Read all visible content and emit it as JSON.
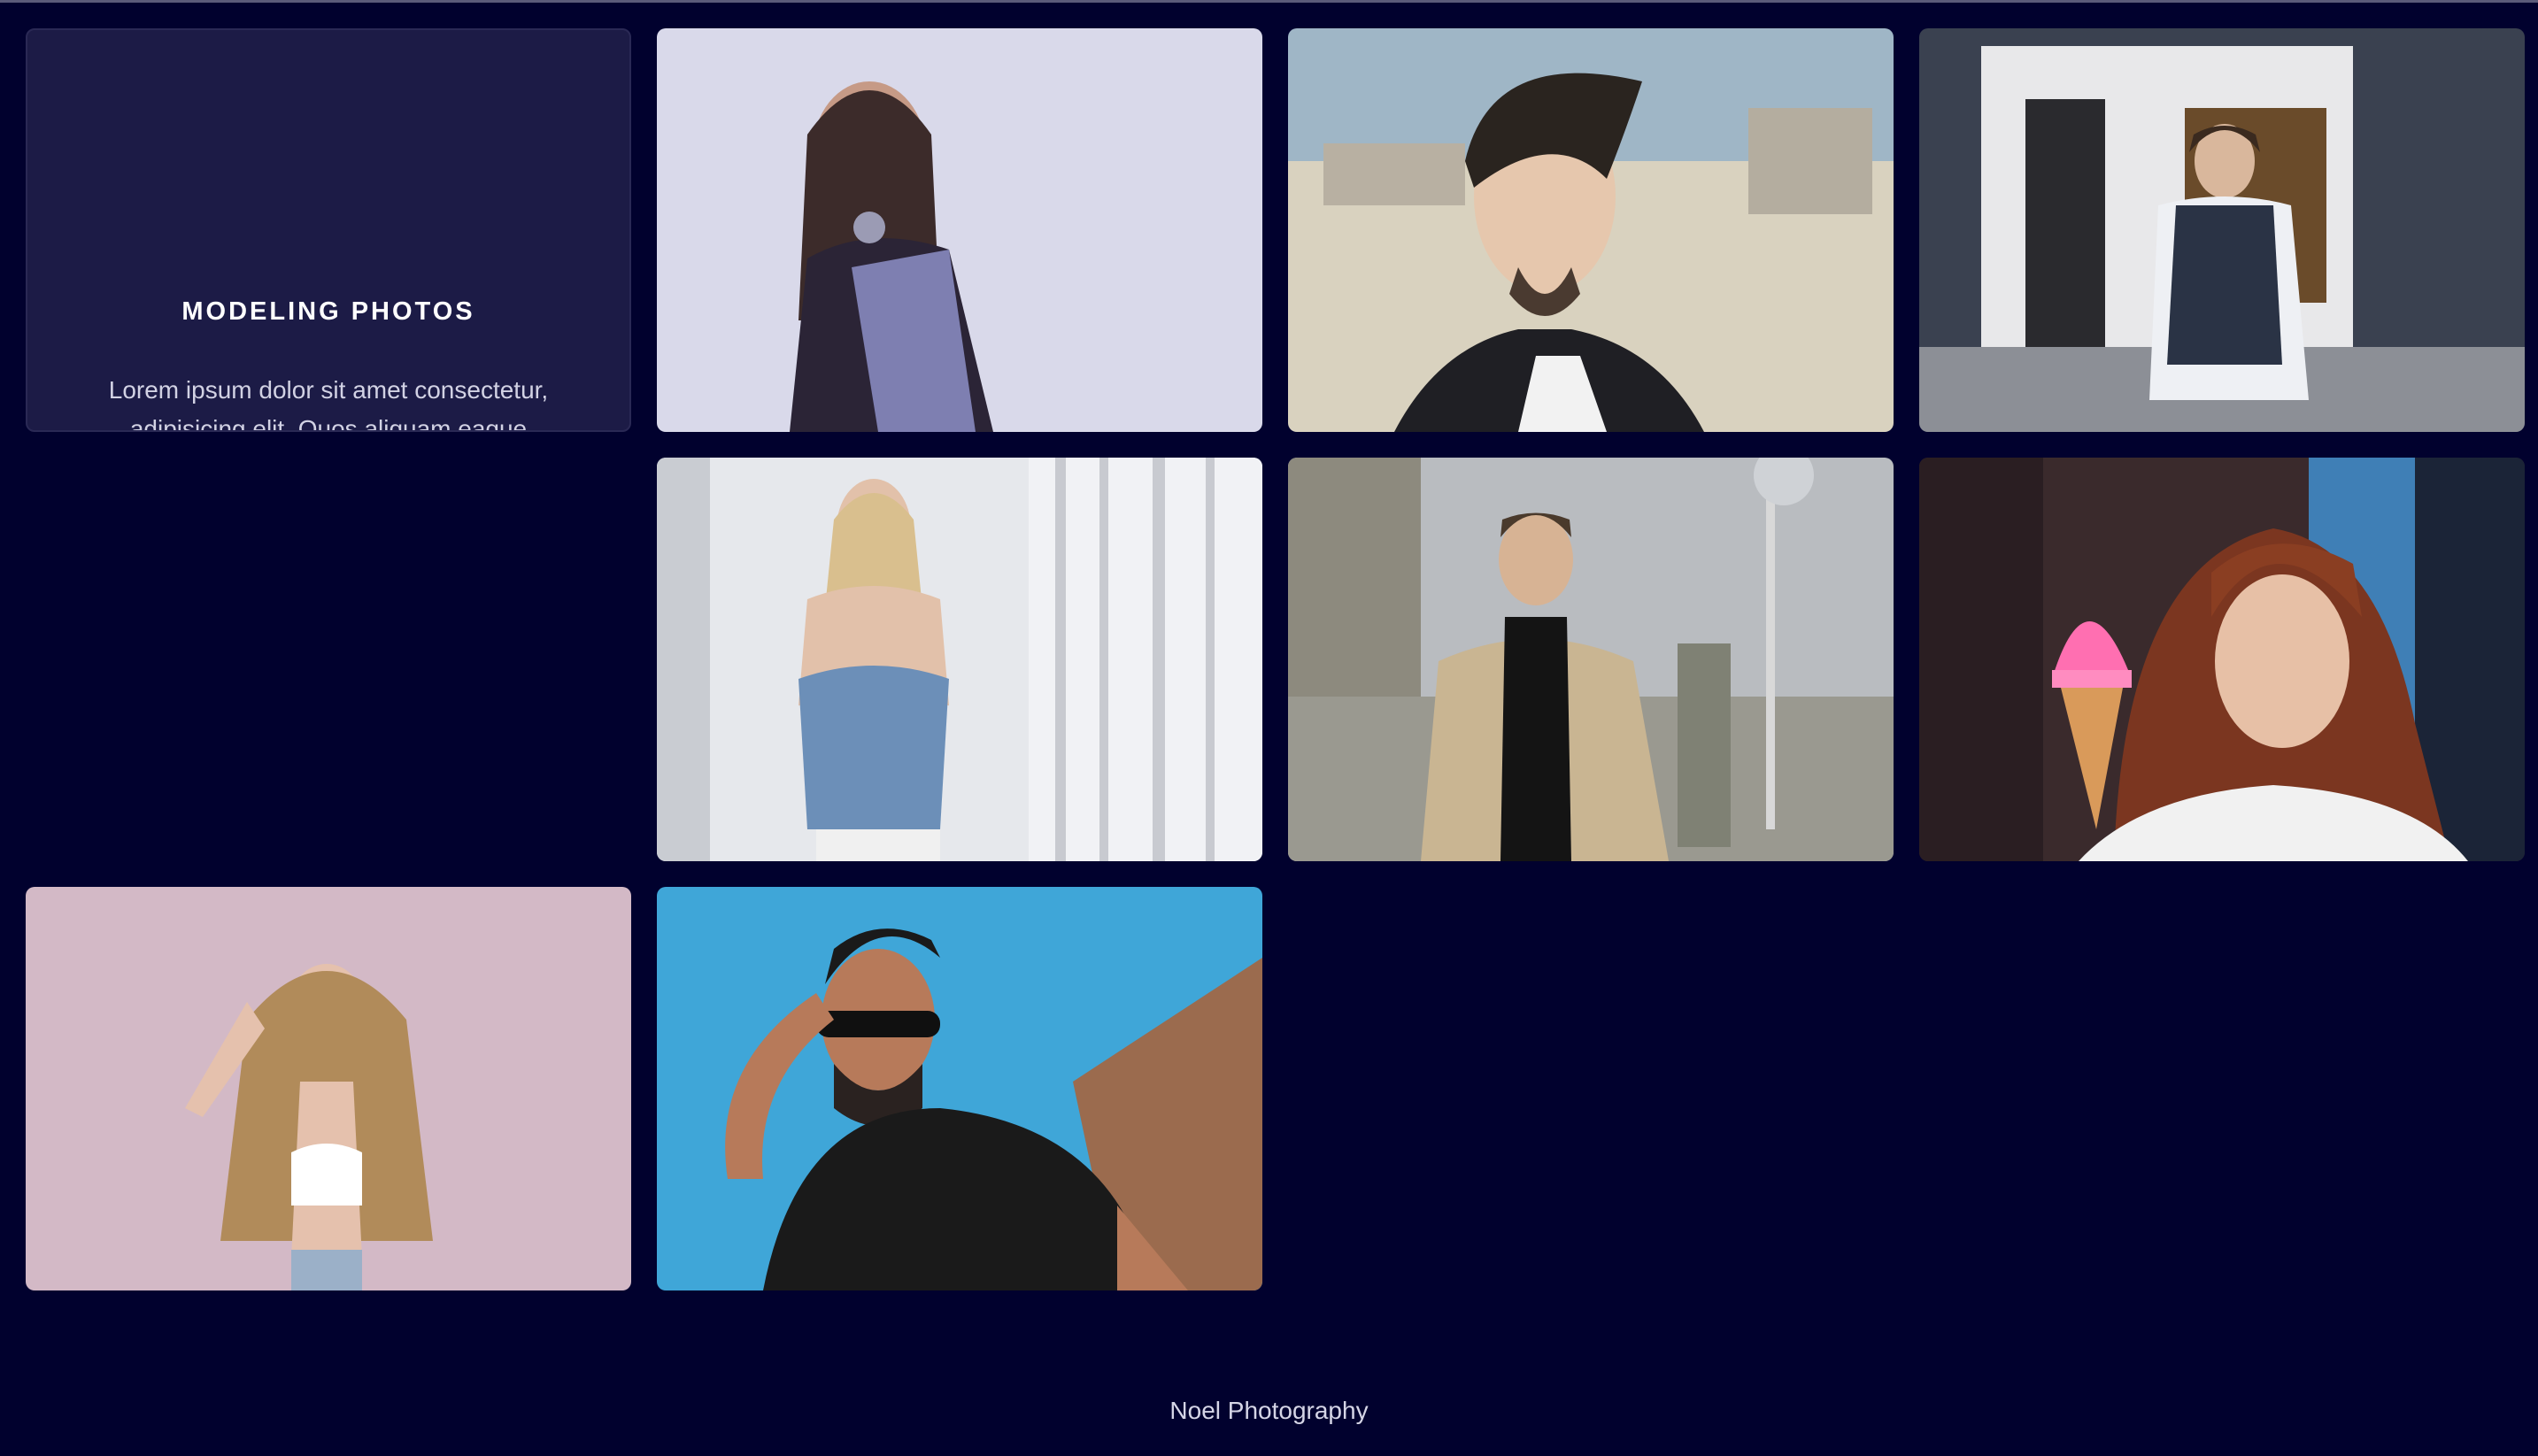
{
  "gallery": {
    "title": "MODELING PHOTOS",
    "description": "Lorem ipsum dolor sit amet consectetur, adipisicing elit. Quos aliquam eaque cupiditate.",
    "photos": [
      {
        "name": "photo-woman-saree-necklace",
        "background": "#d9d9ea",
        "figure": "#2b2436",
        "accent": "#7e7fb1"
      },
      {
        "name": "photo-man-pompadour-beach",
        "background": "#c7c2b0",
        "figure": "#1f1f24",
        "accent": "#e6d3c2"
      },
      {
        "name": "photo-man-vest-storefront",
        "background": "#3a4150",
        "figure": "#2a3345",
        "accent": "#eef0f4"
      },
      {
        "name": "photo-woman-denim-curtains",
        "background": "#e6e8ec",
        "figure": "#6c8fb8",
        "accent": "#e2c1aa"
      },
      {
        "name": "photo-man-coat-street",
        "background": "#9a9990",
        "figure": "#c9b592",
        "accent": "#141414"
      },
      {
        "name": "photo-woman-red-hair-icecream",
        "background": "#3a2a2c",
        "figure": "#7b3620",
        "accent": "#ff6fb1"
      },
      {
        "name": "photo-woman-curly-pink-wall",
        "background": "#d3b9c6",
        "figure": "#b18b5a",
        "accent": "#ffffff"
      },
      {
        "name": "photo-man-sunglasses-sky",
        "background": "#3fa6d8",
        "figure": "#1a1a1a",
        "accent": "#9b6b4e"
      }
    ]
  },
  "footer": {
    "text": "Noel Photography"
  }
}
